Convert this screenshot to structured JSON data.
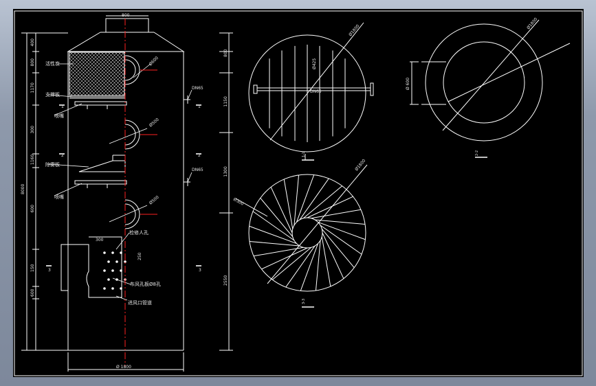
{
  "window": {
    "background": "#000000",
    "frame_color": "#9aa4b6",
    "line_color": "#ffffff",
    "centerline_color": "#ff2020"
  },
  "tower": {
    "top_width_label": "800",
    "bottom_width_label": "Ø 1800",
    "left_dims": [
      "400",
      "800",
      "1170",
      "300",
      "1160",
      "600",
      "150",
      "600"
    ],
    "left_total": "8000",
    "right_dims": [
      "800",
      "1150",
      "1300",
      "2550"
    ],
    "labels": {
      "activated_carbon": "活性炭",
      "support_plate": "支撑板",
      "nozzle_1": "喷嘴",
      "demister": "除雾板",
      "nozzle_2": "喷嘴",
      "ladder": "检修人孔",
      "distribution_plate": "布风孔板Ø8孔",
      "inlet_port": "进风口管道"
    },
    "manhole_labels": [
      "Ø600",
      "Ø500",
      "Ø500"
    ],
    "pipe_labels": [
      "DN65",
      "DN65"
    ],
    "inlet_dims": [
      "300",
      "250"
    ],
    "section_marks": [
      "1",
      "1",
      "2",
      "2",
      "3",
      "3"
    ]
  },
  "views": {
    "view1": {
      "diameter": "Ø1800",
      "inner_dim": "Ø425",
      "pipe": "DN65",
      "caption": "1-1"
    },
    "view2": {
      "diameter": "Ø1800",
      "left_dim": "Ø300",
      "right_dim": "1400",
      "caption": "3-3"
    },
    "view3": {
      "diameter": "Ø1800",
      "left_dim": "Ø 600",
      "caption": "2-2"
    }
  }
}
